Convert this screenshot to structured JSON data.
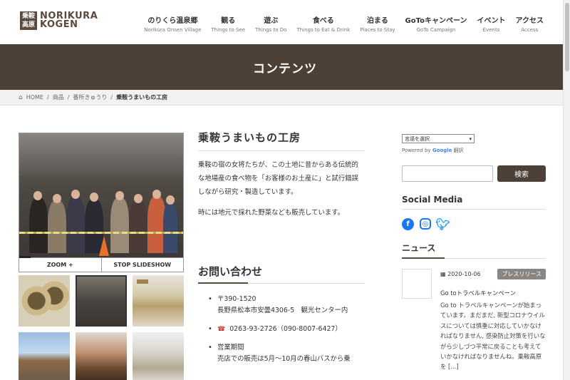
{
  "logo": {
    "mark_top": "乗鞍",
    "mark_bottom": "高原",
    "line1": "NORIKURA",
    "line2": "KOGEN"
  },
  "nav": [
    {
      "jp": "のりくら温泉郷",
      "en": "Norikura Onsen Village"
    },
    {
      "jp": "観る",
      "en": "Things to See"
    },
    {
      "jp": "遊ぶ",
      "en": "Things to Do"
    },
    {
      "jp": "食べる",
      "en": "Things to Eat & Drink"
    },
    {
      "jp": "泊まる",
      "en": "Places to Stay"
    },
    {
      "jp": "GoToキャンペーン",
      "en": "GoTo Campaign"
    },
    {
      "jp": "イベント",
      "en": "Events"
    },
    {
      "jp": "アクセス",
      "en": "Access"
    }
  ],
  "banner": {
    "title": "コンテンツ"
  },
  "breadcrumb": {
    "home": "HOME",
    "item1": "商品",
    "item2": "番所きゅうり",
    "current": "乗鞍うまいもの工房"
  },
  "gallery": {
    "zoom_label": "ZOOM +",
    "stop_label": "STOP SLIDESHOW",
    "progress": 0.07
  },
  "content": {
    "title": "乗鞍うまいもの工房",
    "para1": "乗鞍の宿の女将たちが、この土地に昔からある伝統的な地場産の食べ物を「お客様のお土産に」と試行錯誤しながら研究・製造しています。",
    "para2": "時には地元で採れた野菜なども販売しています。",
    "contact_title": "お問い合わせ",
    "postal": "〒390-1520",
    "address": "長野県松本市安曇4306-5　観光センター内",
    "phone": "0263-93-2726（090-8007-6427）",
    "hours_label": "営業期間",
    "hours_text": "売店での販売は5月～10月の春山バスから乗"
  },
  "sidebar": {
    "lang_select": "言語を選択",
    "powered_by": "Powered by",
    "google": "Google",
    "translate": "翻訳",
    "search_button": "検索",
    "social_title": "Social Media",
    "news_title": "ニュース",
    "news": {
      "date": "2020-10-06",
      "badge": "プレスリリース",
      "title": "Go toトラベルキャンペーン",
      "excerpt": "Go to トラベルキャンペーンが始まっています。まだまだ, 新型コロナウイルスについては慎重に対応していかなければなりません, 感染防止対策を行いながら少しづつ平常に戻ることも考えていかなければなりませんね。乗鞍高原を [...]"
    }
  },
  "icons": {
    "home": "home-icon",
    "phone": "phone-icon",
    "calendar": "calendar-icon",
    "facebook": "facebook-icon",
    "instagram": "instagram-icon",
    "twitter": "twitter-icon"
  },
  "colors": {
    "brand_brown": "#4d4036",
    "badge_gray": "#8a8580",
    "facebook": "#1877f2"
  }
}
